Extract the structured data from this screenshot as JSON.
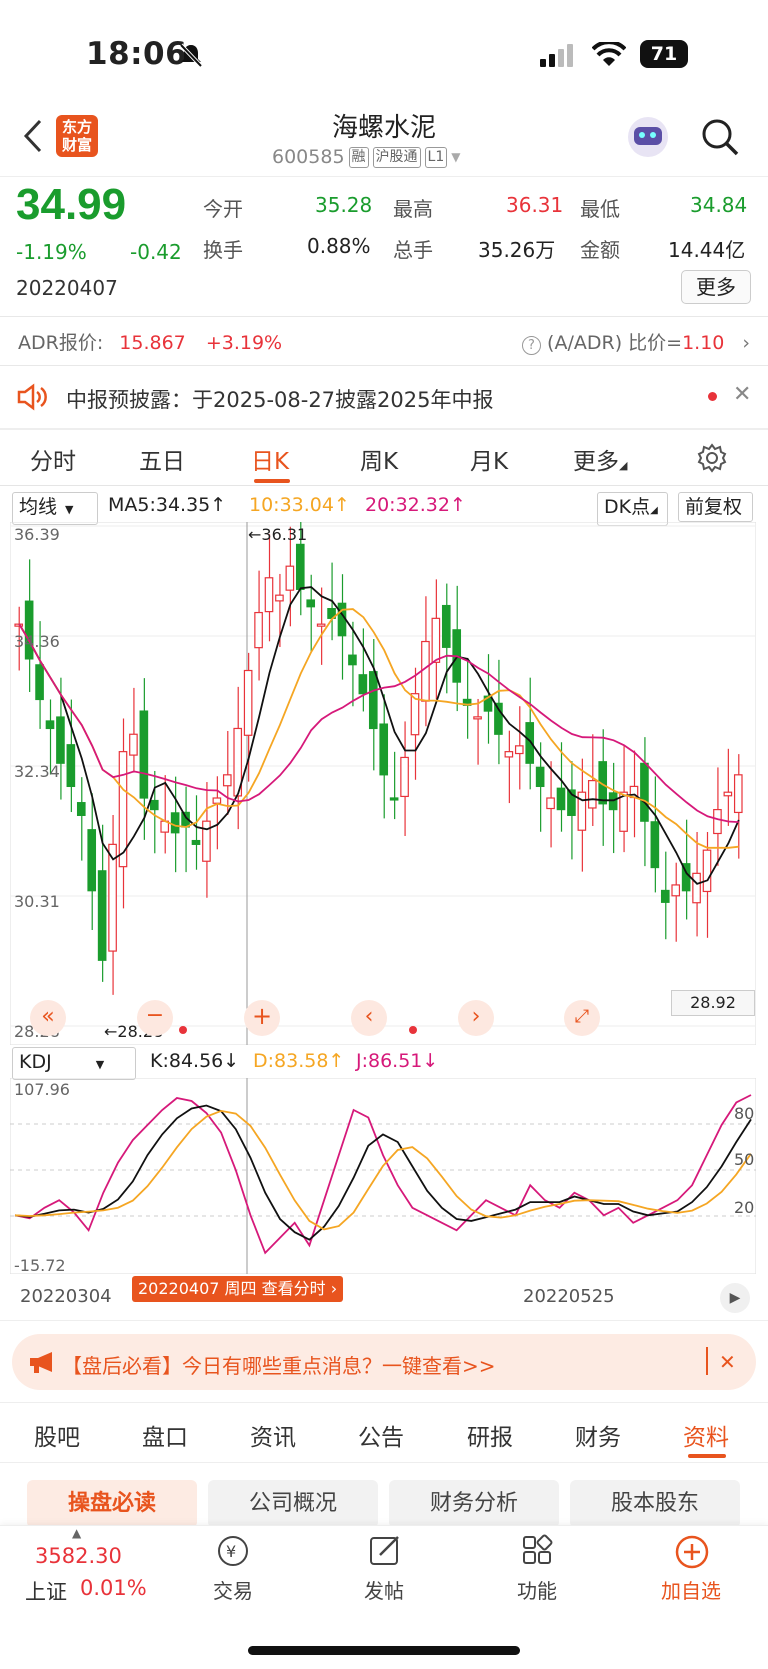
{
  "status": {
    "time": "18:06",
    "battery": "71"
  },
  "header": {
    "stock_name": "海螺水泥",
    "code": "600585",
    "tags": [
      "融",
      "沪股通",
      "L1"
    ],
    "logo_text": "东方财富"
  },
  "quote": {
    "price": "34.99",
    "pct": "-1.19%",
    "chg": "-0.42",
    "date": "20220407",
    "open_label": "今开",
    "open": "35.28",
    "high_label": "最高",
    "high": "36.31",
    "low_label": "最低",
    "low": "34.84",
    "turnover_label": "换手",
    "turnover": "0.88%",
    "volume_label": "总手",
    "volume": "35.26万",
    "amount_label": "金额",
    "amount": "14.44亿",
    "more": "更多"
  },
  "adr": {
    "label": "ADR报价:",
    "price": "15.867",
    "pct": "+3.19%",
    "ratio_label": "(A/ADR) 比价=",
    "ratio": "1.10"
  },
  "notice": {
    "text": "中报预披露：于2025-08-27披露2025年中报"
  },
  "period_tabs": [
    "分时",
    "五日",
    "日K",
    "周K",
    "月K",
    "更多"
  ],
  "kline": {
    "indicator": "均线",
    "ma5": "MA5:34.35↑",
    "ma10": "10:33.04↑",
    "ma20": "20:32.32↑",
    "dk": "DK点",
    "fq": "前复权",
    "y_labels": [
      "36.39",
      "34.36",
      "32.34",
      "30.31",
      "28.28"
    ],
    "high_mark": "←36.31",
    "low_mark": "←28.28",
    "last_box": "28.92",
    "colors": {
      "ma5": "#111111",
      "ma10": "#f5a623",
      "ma20": "#d6197a",
      "up": "#e8333a",
      "down": "#1a9c2d"
    }
  },
  "kdj": {
    "indicator": "KDJ",
    "k": "K:84.56↓",
    "d": "D:83.58↑",
    "j": "J:86.51↓",
    "y_top": "107.96",
    "y_bottom": "-15.72",
    "levels": [
      "80",
      "50",
      "20"
    ]
  },
  "timeline": {
    "dates": [
      "20220304",
      "20220525"
    ],
    "cursor_label": "20220407 周四 查看分时"
  },
  "banner": {
    "text": "【盘后必看】今日有哪些重点消息？一键查看>>"
  },
  "bottom_tabs": [
    "股吧",
    "盘口",
    "资讯",
    "公告",
    "研报",
    "财务",
    "资料"
  ],
  "sub_tabs": [
    "操盘必读",
    "公司概况",
    "财务分析",
    "股本股东"
  ],
  "index": {
    "value": "3582.30",
    "name": "上证",
    "pct": "0.01%"
  },
  "nav": [
    "交易",
    "发帖",
    "功能",
    "加自选"
  ]
}
